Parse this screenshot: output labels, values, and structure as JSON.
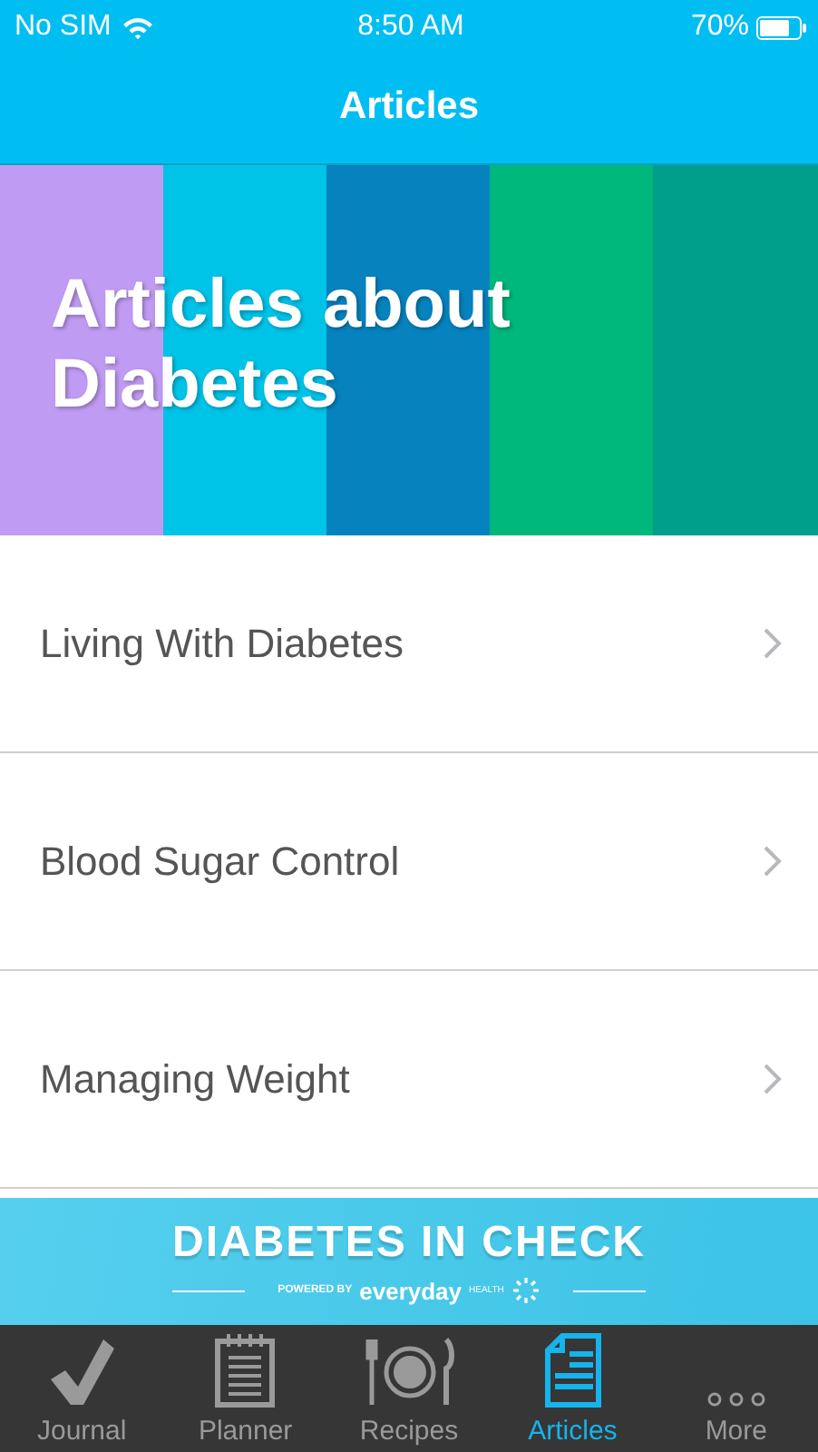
{
  "status_bar": {
    "carrier": "No SIM",
    "time": "8:50 AM",
    "battery": "70%"
  },
  "nav": {
    "title": "Articles"
  },
  "hero": {
    "title": "Articles about Diabetes"
  },
  "articles": [
    {
      "title": "Living With Diabetes"
    },
    {
      "title": "Blood Sugar Control"
    },
    {
      "title": "Managing Weight"
    }
  ],
  "ad": {
    "title": "DIABETES IN CHECK",
    "powered_by": "POWERED BY",
    "brand": "everyday",
    "brand_suffix": "HEALTH"
  },
  "tabs": [
    {
      "label": "Journal",
      "kind": "check",
      "selected": false
    },
    {
      "label": "Planner",
      "kind": "notepad",
      "selected": false
    },
    {
      "label": "Recipes",
      "kind": "plate",
      "selected": false
    },
    {
      "label": "Articles",
      "kind": "document",
      "selected": true
    },
    {
      "label": "More",
      "kind": "dots",
      "selected": false
    }
  ]
}
